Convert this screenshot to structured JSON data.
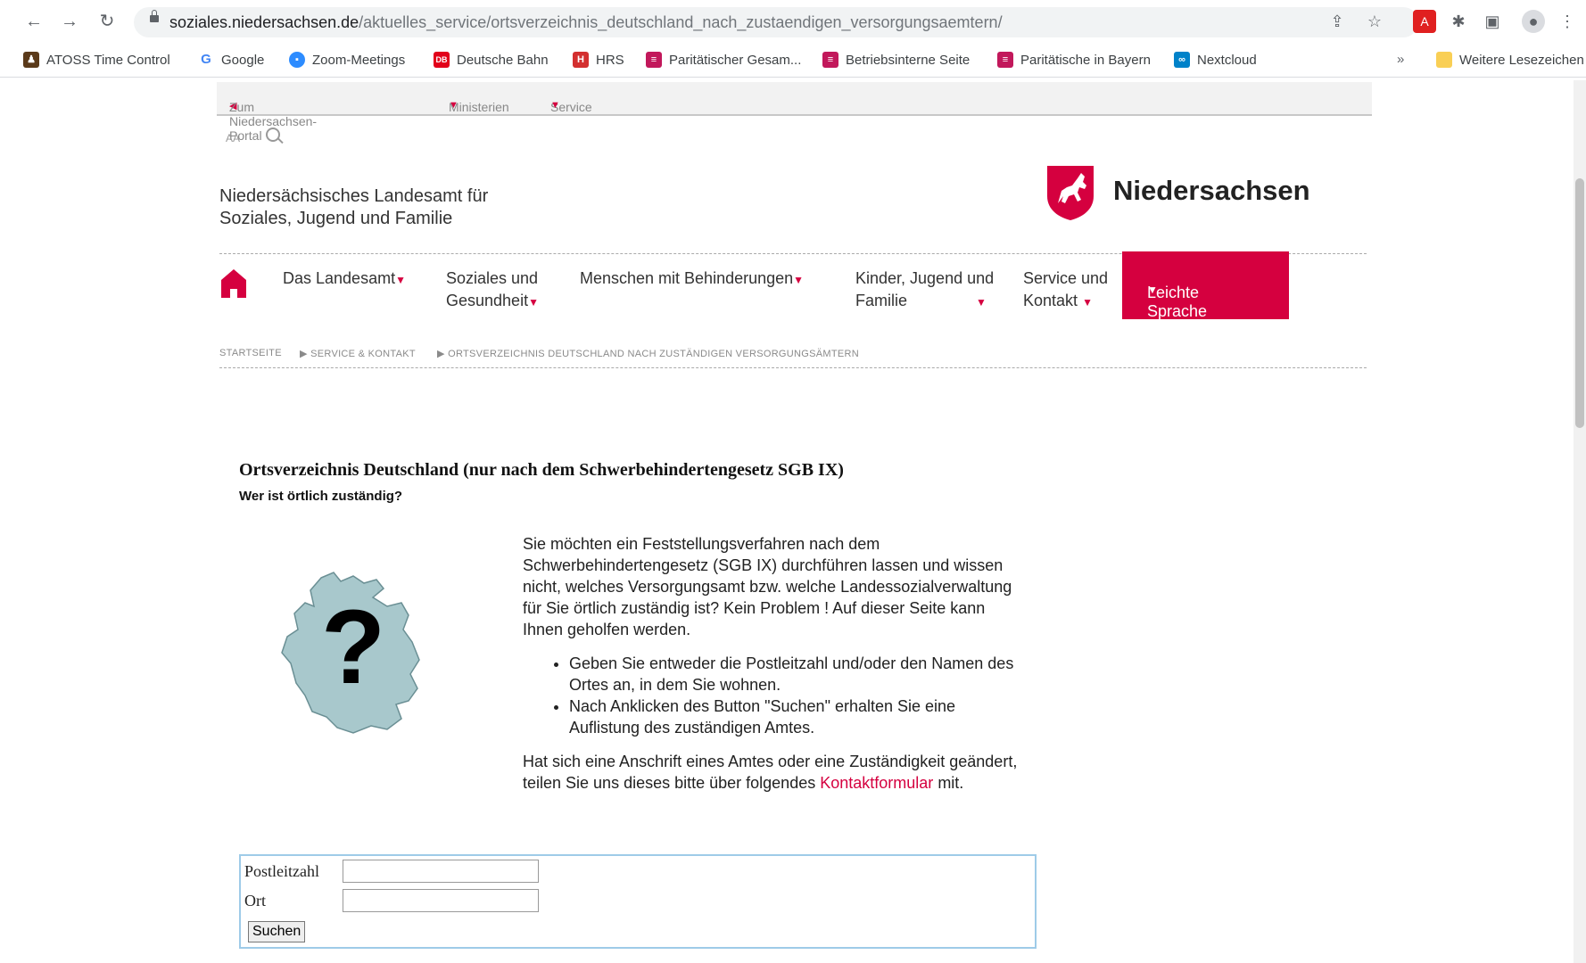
{
  "browser": {
    "url_domain": "soziales.niedersachsen.de",
    "url_path": "/aktuelles_service/ortsverzeichnis_deutschland_nach_zustaendigen_versorgungsaemtern/"
  },
  "bookmarks": [
    {
      "label": "ATOSS Time Control",
      "color": "#5b3a1a"
    },
    {
      "label": "Google",
      "color": "#4285f4"
    },
    {
      "label": "Zoom-Meetings",
      "color": "#2d8cff"
    },
    {
      "label": "Deutsche Bahn",
      "color": "#e2001a"
    },
    {
      "label": "HRS",
      "color": "#d32f2f"
    },
    {
      "label": "Paritätischer Gesam...",
      "color": "#c2185b"
    },
    {
      "label": "Betriebsinterne Seite",
      "color": "#c2185b"
    },
    {
      "label": "Paritätische in Bayern",
      "color": "#c2185b"
    },
    {
      "label": "Nextcloud",
      "color": "#0082c9"
    }
  ],
  "bookmarks_more": "»",
  "bookmarks_other": "Weitere Lesezeichen",
  "utility": {
    "portal": "Zum Niedersachsen-Portal",
    "ministerien": "Ministerien",
    "service": "Service"
  },
  "tools": {
    "font_size": "AA"
  },
  "header": {
    "agency_line1": "Niedersächsisches Landesamt für",
    "agency_line2": "Soziales, Jugend und Familie",
    "logo_text": "Niedersachsen"
  },
  "menu": {
    "landesamt": "Das Landesamt",
    "soziales_l1": "Soziales und",
    "soziales_l2": "Gesundheit",
    "menschen": "Menschen mit Behinderungen",
    "kinder_l1": "Kinder, Jugend und",
    "kinder_l2": "Familie",
    "service_l1": "Service und",
    "service_l2": "Kontakt",
    "leichte": "Leichte Sprache"
  },
  "breadcrumb": {
    "home": "STARTSEITE",
    "service": "SERVICE & KONTAKT",
    "current": "ORTSVERZEICHNIS DEUTSCHLAND NACH ZUSTÄNDIGEN VERSORGUNGSÄMTERN"
  },
  "content": {
    "title": "Ortsverzeichnis Deutschland (nur nach dem Schwerbehindertengesetz SGB IX)",
    "subtitle": "Wer ist örtlich zuständig?",
    "intro": "Sie möchten ein Feststellungsverfahren nach dem Schwerbehindertengesetz (SGB IX) durchführen lassen und wissen nicht, welches Versorgungsamt bzw. welche Landessozialverwaltung für Sie örtlich zuständig ist? Kein Problem ! Auf dieser Seite kann Ihnen geholfen werden.",
    "bullet1": "Geben Sie entweder die Postleitzahl und/oder den Namen des Ortes an, in dem Sie wohnen.",
    "bullet2": "Nach Anklicken des Button \"Suchen\" erhalten Sie eine Auflistung des zuständigen Amtes.",
    "notice_before": "Hat sich eine Anschrift eines Amtes oder eine Zuständigkeit geändert, teilen Sie uns dieses bitte über folgendes",
    "notice_link": "Kontaktformular",
    "notice_after": "mit."
  },
  "form": {
    "plz_label": "Postleitzahl",
    "plz_value": "",
    "ort_label": "Ort",
    "ort_value": "",
    "submit": "Suchen"
  },
  "colors": {
    "accent": "#d5003f",
    "form_border": "#9ecbe8",
    "map_fill": "#a8c8cc"
  }
}
